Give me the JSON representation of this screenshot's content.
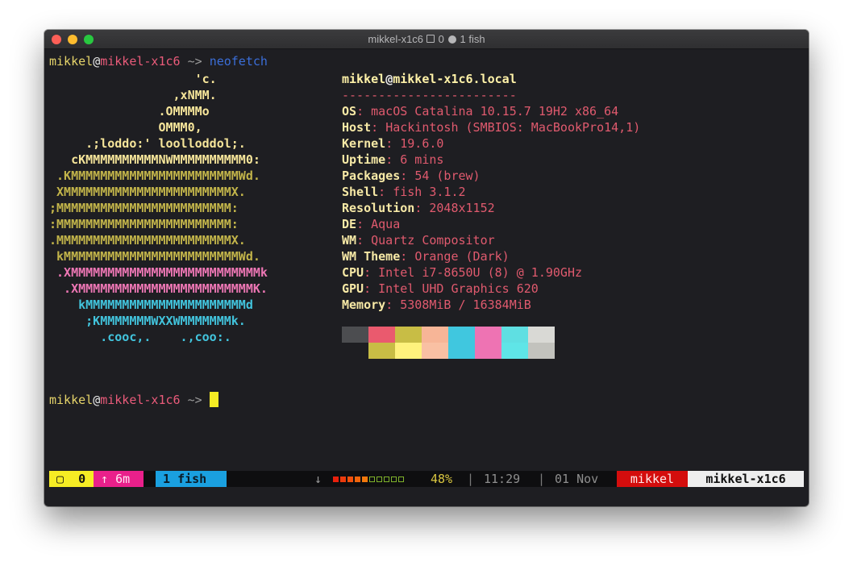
{
  "window": {
    "title_session": "mikkel-x1c6",
    "title_panes": "0",
    "title_window": "1 fish"
  },
  "prompt": {
    "user": "mikkel",
    "at": "@",
    "host": "mikkel-x1c6",
    "arrow": " ~> ",
    "command": "neofetch"
  },
  "ascii_art": [
    {
      "color": "c1",
      "text": "                    'c."
    },
    {
      "color": "c1",
      "text": "                 ,xNMM."
    },
    {
      "color": "c1",
      "text": "               .OMMMMo"
    },
    {
      "color": "c1",
      "text": "               OMMM0,"
    },
    {
      "color": "c1",
      "text": "     .;loddo:' loolloddol;."
    },
    {
      "color": "c1",
      "text": "   cKMMMMMMMMMMNWMMMMMMMMMM0:"
    },
    {
      "color": "c2",
      "text": " .KMMMMMMMMMMMMMMMMMMMMMMMWd."
    },
    {
      "color": "c2",
      "text": " XMMMMMMMMMMMMMMMMMMMMMMMX."
    },
    {
      "color": "c2",
      "text": ";MMMMMMMMMMMMMMMMMMMMMMMM:"
    },
    {
      "color": "c2",
      "text": ":MMMMMMMMMMMMMMMMMMMMMMMM:"
    },
    {
      "color": "c2",
      "text": ".MMMMMMMMMMMMMMMMMMMMMMMMX."
    },
    {
      "color": "c2",
      "text": " kMMMMMMMMMMMMMMMMMMMMMMMMWd."
    },
    {
      "color": "c3",
      "text": " .XMMMMMMMMMMMMMMMMMMMMMMMMMMk"
    },
    {
      "color": "c3",
      "text": "  .XMMMMMMMMMMMMMMMMMMMMMMMMK."
    },
    {
      "color": "c4",
      "text": "    kMMMMMMMMMMMMMMMMMMMMMMd"
    },
    {
      "color": "c4",
      "text": "     ;KMMMMMMMWXXWMMMMMMMk."
    },
    {
      "color": "c4",
      "text": "       .cooc,.    .,coo:."
    }
  ],
  "info": {
    "title_user": "mikkel",
    "title_at": "@",
    "title_host": "mikkel-x1c6.local",
    "separator": "------------------------",
    "rows": [
      {
        "key": "OS",
        "value": "macOS Catalina 10.15.7 19H2 x86_64"
      },
      {
        "key": "Host",
        "value": "Hackintosh (SMBIOS: MacBookPro14,1)"
      },
      {
        "key": "Kernel",
        "value": "19.6.0"
      },
      {
        "key": "Uptime",
        "value": "6 mins"
      },
      {
        "key": "Packages",
        "value": "54 (brew)"
      },
      {
        "key": "Shell",
        "value": "fish 3.1.2"
      },
      {
        "key": "Resolution",
        "value": "2048x1152"
      },
      {
        "key": "DE",
        "value": "Aqua"
      },
      {
        "key": "WM",
        "value": "Quartz Compositor"
      },
      {
        "key": "WM Theme",
        "value": "Orange (Dark)"
      },
      {
        "key": "CPU",
        "value": "Intel i7-8650U (8) @ 1.90GHz"
      },
      {
        "key": "GPU",
        "value": "Intel UHD Graphics 620"
      },
      {
        "key": "Memory",
        "value": "5308MiB / 16384MiB"
      }
    ],
    "colon": ": "
  },
  "palette": {
    "normal": [
      "#4c4d50",
      "#ea5a6e",
      "#c8bd45",
      "#f7b597",
      "#40c7df",
      "#ee73b3",
      "#5fdfe2",
      "#d9d9d5"
    ],
    "bright": [
      "#1e1e22",
      "#c8bd45",
      "#fff27d",
      "#f9c0a3",
      "#40c7df",
      "#ee73b3",
      "#5fe5e7",
      "#c2c2bd"
    ]
  },
  "prompt2": {
    "user": "mikkel",
    "at": "@",
    "host": "mikkel-x1c6",
    "arrow": " ~> "
  },
  "statusbar": {
    "session_icon": "▢",
    "session": "0",
    "uptime_icon": "↑",
    "uptime": "6m",
    "window": "1 fish",
    "battery_icon": "↓",
    "battery_bars": [
      "full",
      "full",
      "full",
      "full",
      "full",
      "empty",
      "empty",
      "empty",
      "empty",
      "empty"
    ],
    "battery": "48%",
    "divider": "|",
    "time": "11:29",
    "date": "01 Nov",
    "user": "mikkel",
    "host": "mikkel-x1c6"
  }
}
